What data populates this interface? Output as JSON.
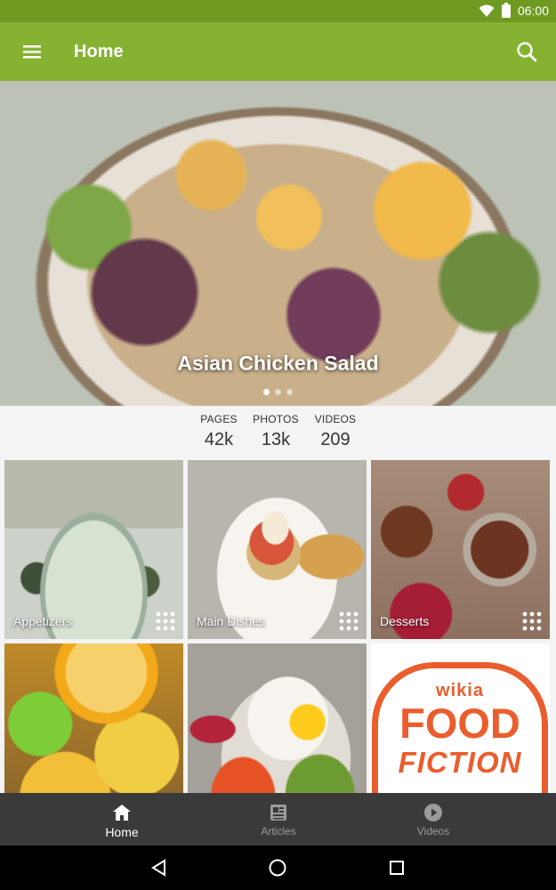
{
  "status_bar": {
    "time": "06:00",
    "wifi_icon": "wifi-icon",
    "battery_icon": "battery-icon"
  },
  "app_bar": {
    "title": "Home",
    "menu_icon": "menu-icon",
    "search_icon": "search-icon",
    "background": "#86b232"
  },
  "hero": {
    "title": "Asian Chicken Salad",
    "dots_total": 3,
    "active_dot": 1
  },
  "stats": [
    {
      "label": "PAGES",
      "value": "42k"
    },
    {
      "label": "PHOTOS",
      "value": "13k"
    },
    {
      "label": "VIDEOS",
      "value": "209"
    }
  ],
  "tiles": [
    {
      "label": "Appetizers"
    },
    {
      "label": "Main Dishes"
    },
    {
      "label": "Desserts"
    },
    {
      "label": ""
    },
    {
      "label": ""
    },
    {
      "label": ""
    }
  ],
  "brand_logo": {
    "top": "wikia",
    "line1": "FOOD",
    "line2": "FICTION",
    "color": "#ea5d2c"
  },
  "bottom_nav": [
    {
      "label": "Home",
      "icon": "home-icon",
      "active": true
    },
    {
      "label": "Articles",
      "icon": "articles-icon",
      "active": false
    },
    {
      "label": "Videos",
      "icon": "play-icon",
      "active": false
    }
  ],
  "system_nav": [
    "back-icon",
    "home-circle-icon",
    "recents-icon"
  ]
}
